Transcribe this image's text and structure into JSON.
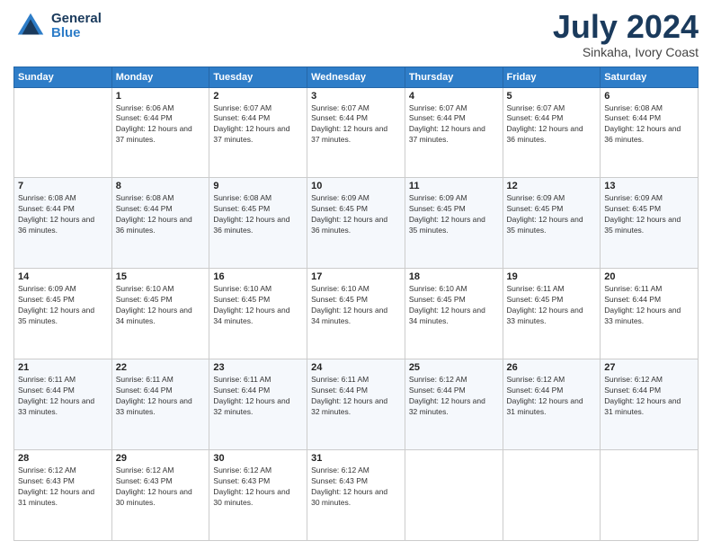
{
  "header": {
    "logo_line1": "General",
    "logo_line2": "Blue",
    "month_year": "July 2024",
    "location": "Sinkaha, Ivory Coast"
  },
  "days_of_week": [
    "Sunday",
    "Monday",
    "Tuesday",
    "Wednesday",
    "Thursday",
    "Friday",
    "Saturday"
  ],
  "weeks": [
    [
      {
        "day": "",
        "sunrise": "",
        "sunset": "",
        "daylight": ""
      },
      {
        "day": "1",
        "sunrise": "Sunrise: 6:06 AM",
        "sunset": "Sunset: 6:44 PM",
        "daylight": "Daylight: 12 hours and 37 minutes."
      },
      {
        "day": "2",
        "sunrise": "Sunrise: 6:07 AM",
        "sunset": "Sunset: 6:44 PM",
        "daylight": "Daylight: 12 hours and 37 minutes."
      },
      {
        "day": "3",
        "sunrise": "Sunrise: 6:07 AM",
        "sunset": "Sunset: 6:44 PM",
        "daylight": "Daylight: 12 hours and 37 minutes."
      },
      {
        "day": "4",
        "sunrise": "Sunrise: 6:07 AM",
        "sunset": "Sunset: 6:44 PM",
        "daylight": "Daylight: 12 hours and 37 minutes."
      },
      {
        "day": "5",
        "sunrise": "Sunrise: 6:07 AM",
        "sunset": "Sunset: 6:44 PM",
        "daylight": "Daylight: 12 hours and 36 minutes."
      },
      {
        "day": "6",
        "sunrise": "Sunrise: 6:08 AM",
        "sunset": "Sunset: 6:44 PM",
        "daylight": "Daylight: 12 hours and 36 minutes."
      }
    ],
    [
      {
        "day": "7",
        "sunrise": "Sunrise: 6:08 AM",
        "sunset": "Sunset: 6:44 PM",
        "daylight": "Daylight: 12 hours and 36 minutes."
      },
      {
        "day": "8",
        "sunrise": "Sunrise: 6:08 AM",
        "sunset": "Sunset: 6:44 PM",
        "daylight": "Daylight: 12 hours and 36 minutes."
      },
      {
        "day": "9",
        "sunrise": "Sunrise: 6:08 AM",
        "sunset": "Sunset: 6:45 PM",
        "daylight": "Daylight: 12 hours and 36 minutes."
      },
      {
        "day": "10",
        "sunrise": "Sunrise: 6:09 AM",
        "sunset": "Sunset: 6:45 PM",
        "daylight": "Daylight: 12 hours and 36 minutes."
      },
      {
        "day": "11",
        "sunrise": "Sunrise: 6:09 AM",
        "sunset": "Sunset: 6:45 PM",
        "daylight": "Daylight: 12 hours and 35 minutes."
      },
      {
        "day": "12",
        "sunrise": "Sunrise: 6:09 AM",
        "sunset": "Sunset: 6:45 PM",
        "daylight": "Daylight: 12 hours and 35 minutes."
      },
      {
        "day": "13",
        "sunrise": "Sunrise: 6:09 AM",
        "sunset": "Sunset: 6:45 PM",
        "daylight": "Daylight: 12 hours and 35 minutes."
      }
    ],
    [
      {
        "day": "14",
        "sunrise": "Sunrise: 6:09 AM",
        "sunset": "Sunset: 6:45 PM",
        "daylight": "Daylight: 12 hours and 35 minutes."
      },
      {
        "day": "15",
        "sunrise": "Sunrise: 6:10 AM",
        "sunset": "Sunset: 6:45 PM",
        "daylight": "Daylight: 12 hours and 34 minutes."
      },
      {
        "day": "16",
        "sunrise": "Sunrise: 6:10 AM",
        "sunset": "Sunset: 6:45 PM",
        "daylight": "Daylight: 12 hours and 34 minutes."
      },
      {
        "day": "17",
        "sunrise": "Sunrise: 6:10 AM",
        "sunset": "Sunset: 6:45 PM",
        "daylight": "Daylight: 12 hours and 34 minutes."
      },
      {
        "day": "18",
        "sunrise": "Sunrise: 6:10 AM",
        "sunset": "Sunset: 6:45 PM",
        "daylight": "Daylight: 12 hours and 34 minutes."
      },
      {
        "day": "19",
        "sunrise": "Sunrise: 6:11 AM",
        "sunset": "Sunset: 6:45 PM",
        "daylight": "Daylight: 12 hours and 33 minutes."
      },
      {
        "day": "20",
        "sunrise": "Sunrise: 6:11 AM",
        "sunset": "Sunset: 6:44 PM",
        "daylight": "Daylight: 12 hours and 33 minutes."
      }
    ],
    [
      {
        "day": "21",
        "sunrise": "Sunrise: 6:11 AM",
        "sunset": "Sunset: 6:44 PM",
        "daylight": "Daylight: 12 hours and 33 minutes."
      },
      {
        "day": "22",
        "sunrise": "Sunrise: 6:11 AM",
        "sunset": "Sunset: 6:44 PM",
        "daylight": "Daylight: 12 hours and 33 minutes."
      },
      {
        "day": "23",
        "sunrise": "Sunrise: 6:11 AM",
        "sunset": "Sunset: 6:44 PM",
        "daylight": "Daylight: 12 hours and 32 minutes."
      },
      {
        "day": "24",
        "sunrise": "Sunrise: 6:11 AM",
        "sunset": "Sunset: 6:44 PM",
        "daylight": "Daylight: 12 hours and 32 minutes."
      },
      {
        "day": "25",
        "sunrise": "Sunrise: 6:12 AM",
        "sunset": "Sunset: 6:44 PM",
        "daylight": "Daylight: 12 hours and 32 minutes."
      },
      {
        "day": "26",
        "sunrise": "Sunrise: 6:12 AM",
        "sunset": "Sunset: 6:44 PM",
        "daylight": "Daylight: 12 hours and 31 minutes."
      },
      {
        "day": "27",
        "sunrise": "Sunrise: 6:12 AM",
        "sunset": "Sunset: 6:44 PM",
        "daylight": "Daylight: 12 hours and 31 minutes."
      }
    ],
    [
      {
        "day": "28",
        "sunrise": "Sunrise: 6:12 AM",
        "sunset": "Sunset: 6:43 PM",
        "daylight": "Daylight: 12 hours and 31 minutes."
      },
      {
        "day": "29",
        "sunrise": "Sunrise: 6:12 AM",
        "sunset": "Sunset: 6:43 PM",
        "daylight": "Daylight: 12 hours and 30 minutes."
      },
      {
        "day": "30",
        "sunrise": "Sunrise: 6:12 AM",
        "sunset": "Sunset: 6:43 PM",
        "daylight": "Daylight: 12 hours and 30 minutes."
      },
      {
        "day": "31",
        "sunrise": "Sunrise: 6:12 AM",
        "sunset": "Sunset: 6:43 PM",
        "daylight": "Daylight: 12 hours and 30 minutes."
      },
      {
        "day": "",
        "sunrise": "",
        "sunset": "",
        "daylight": ""
      },
      {
        "day": "",
        "sunrise": "",
        "sunset": "",
        "daylight": ""
      },
      {
        "day": "",
        "sunrise": "",
        "sunset": "",
        "daylight": ""
      }
    ]
  ]
}
